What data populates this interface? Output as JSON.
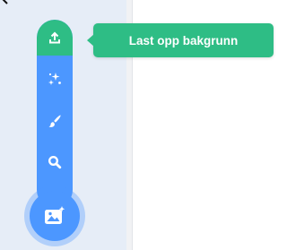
{
  "backdrop_menu": {
    "items": [
      {
        "icon": "upload-icon",
        "active": true
      },
      {
        "icon": "surprise-icon",
        "active": false
      },
      {
        "icon": "paint-icon",
        "active": false
      },
      {
        "icon": "search-icon",
        "active": false
      }
    ],
    "main_button_icon": "choose-backdrop-icon",
    "tooltip": "Last opp bakgrunn"
  },
  "colors": {
    "menu_blue": "#4c97ff",
    "active_green": "#2ebd85",
    "sidebar_bg": "#e6edf7",
    "icon_white": "#ffffff"
  }
}
